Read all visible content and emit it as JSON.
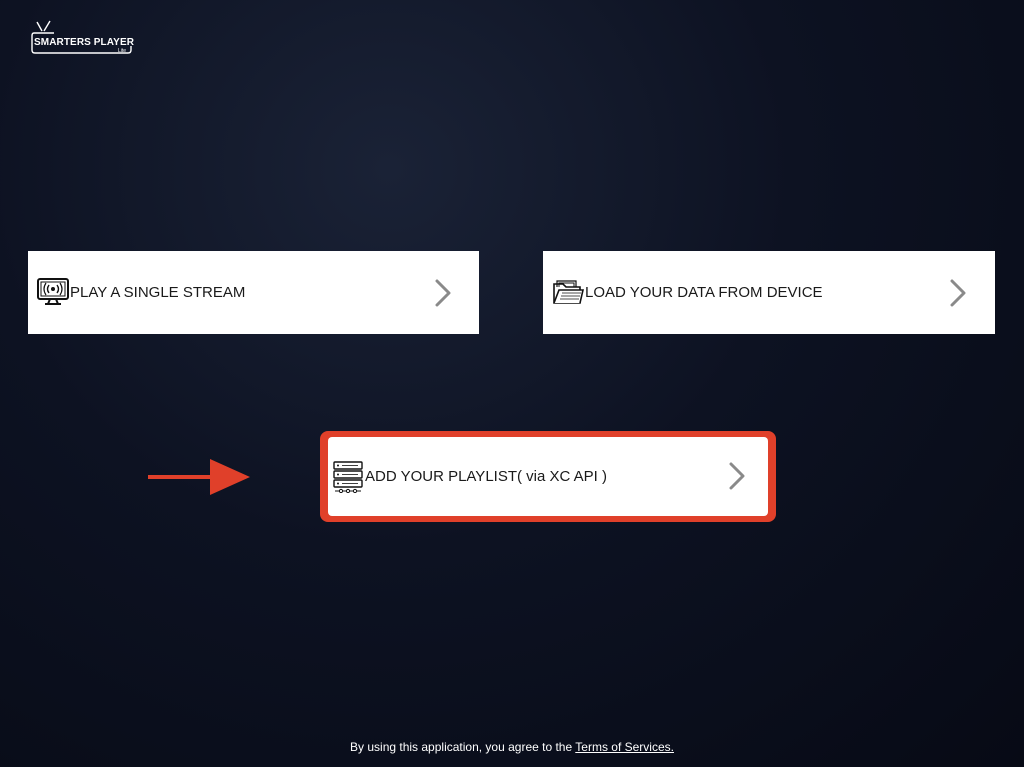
{
  "app": {
    "brand": "SMARTERS PLAYER",
    "brand_sub": "Lite"
  },
  "cards": {
    "single_stream": {
      "label": "PLAY A SINGLE STREAM",
      "icon": "broadcast-monitor-icon"
    },
    "load_device": {
      "label": "LOAD YOUR DATA FROM DEVICE",
      "icon": "folder-icon"
    },
    "playlist": {
      "label": "ADD YOUR PLAYLIST( via XC API )",
      "icon": "server-icon"
    }
  },
  "footer": {
    "text": "By using this application, you agree to the ",
    "link": "Terms of Services."
  },
  "colors": {
    "highlight": "#e0402a",
    "card_bg": "#ffffff",
    "chevron": "#8a8a8a"
  }
}
